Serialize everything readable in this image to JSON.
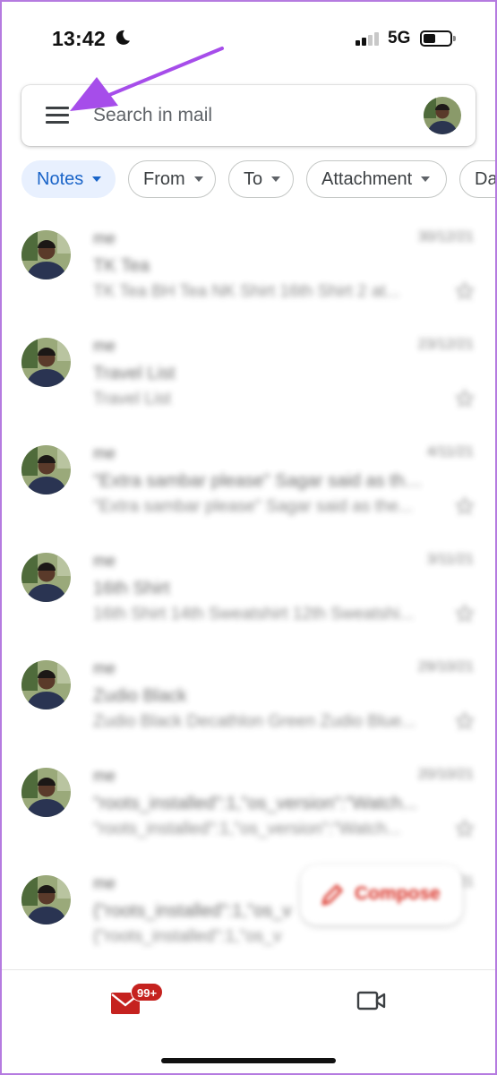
{
  "status_bar": {
    "time": "13:42",
    "network": "5G",
    "icons": [
      "moon-icon",
      "signal-icon",
      "battery-icon"
    ]
  },
  "search": {
    "placeholder": "Search in mail",
    "menu_icon": "hamburger-menu-icon",
    "avatar_icon": "account-avatar"
  },
  "filters": [
    {
      "label": "Notes",
      "active": true
    },
    {
      "label": "From",
      "active": false
    },
    {
      "label": "To",
      "active": false
    },
    {
      "label": "Attachment",
      "active": false
    },
    {
      "label": "Da",
      "active": false
    }
  ],
  "mails": [
    {
      "sender": "me",
      "date": "30/12/21",
      "subject": "TK Tea",
      "snippet": "TK Tea BH Tea NK Shirt 16th Shirt 2 at..."
    },
    {
      "sender": "me",
      "date": "23/12/21",
      "subject": "Travel List",
      "snippet": "Travel List"
    },
    {
      "sender": "me",
      "date": "4/11/21",
      "subject": "\"Extra sambar please\" Sagar said as the...",
      "snippet": "\"Extra sambar please\" Sagar said as the..."
    },
    {
      "sender": "me",
      "date": "3/11/21",
      "subject": "16th Shirt",
      "snippet": "16th Shirt 14th Sweatshirt 12th Sweatshi..."
    },
    {
      "sender": "me",
      "date": "29/10/21",
      "subject": "Zudio Black",
      "snippet": "Zudio Black Decathlon Green Zudio Blue..."
    },
    {
      "sender": "me",
      "date": "20/10/21",
      "subject": "\"roots_installed\":1,\"os_version\":\"Watch...",
      "snippet": "\"roots_installed\":1,\"os_version\":\"Watch..."
    },
    {
      "sender": "me",
      "date": "20/10/21",
      "subject": "{\"roots_installed\":1,\"os_v",
      "snippet": "{\"roots_installed\":1,\"os_v"
    }
  ],
  "compose": {
    "label": "Compose",
    "icon": "pencil-icon"
  },
  "bottom_nav": {
    "mail_badge": "99+",
    "mail_icon": "mail-icon",
    "meet_icon": "video-camera-icon"
  },
  "colors": {
    "accent_chip_bg": "#e8f0fe",
    "accent_chip_text": "#1a64c8",
    "brand_red": "#c5221f",
    "annotation_arrow": "#a64dea"
  }
}
